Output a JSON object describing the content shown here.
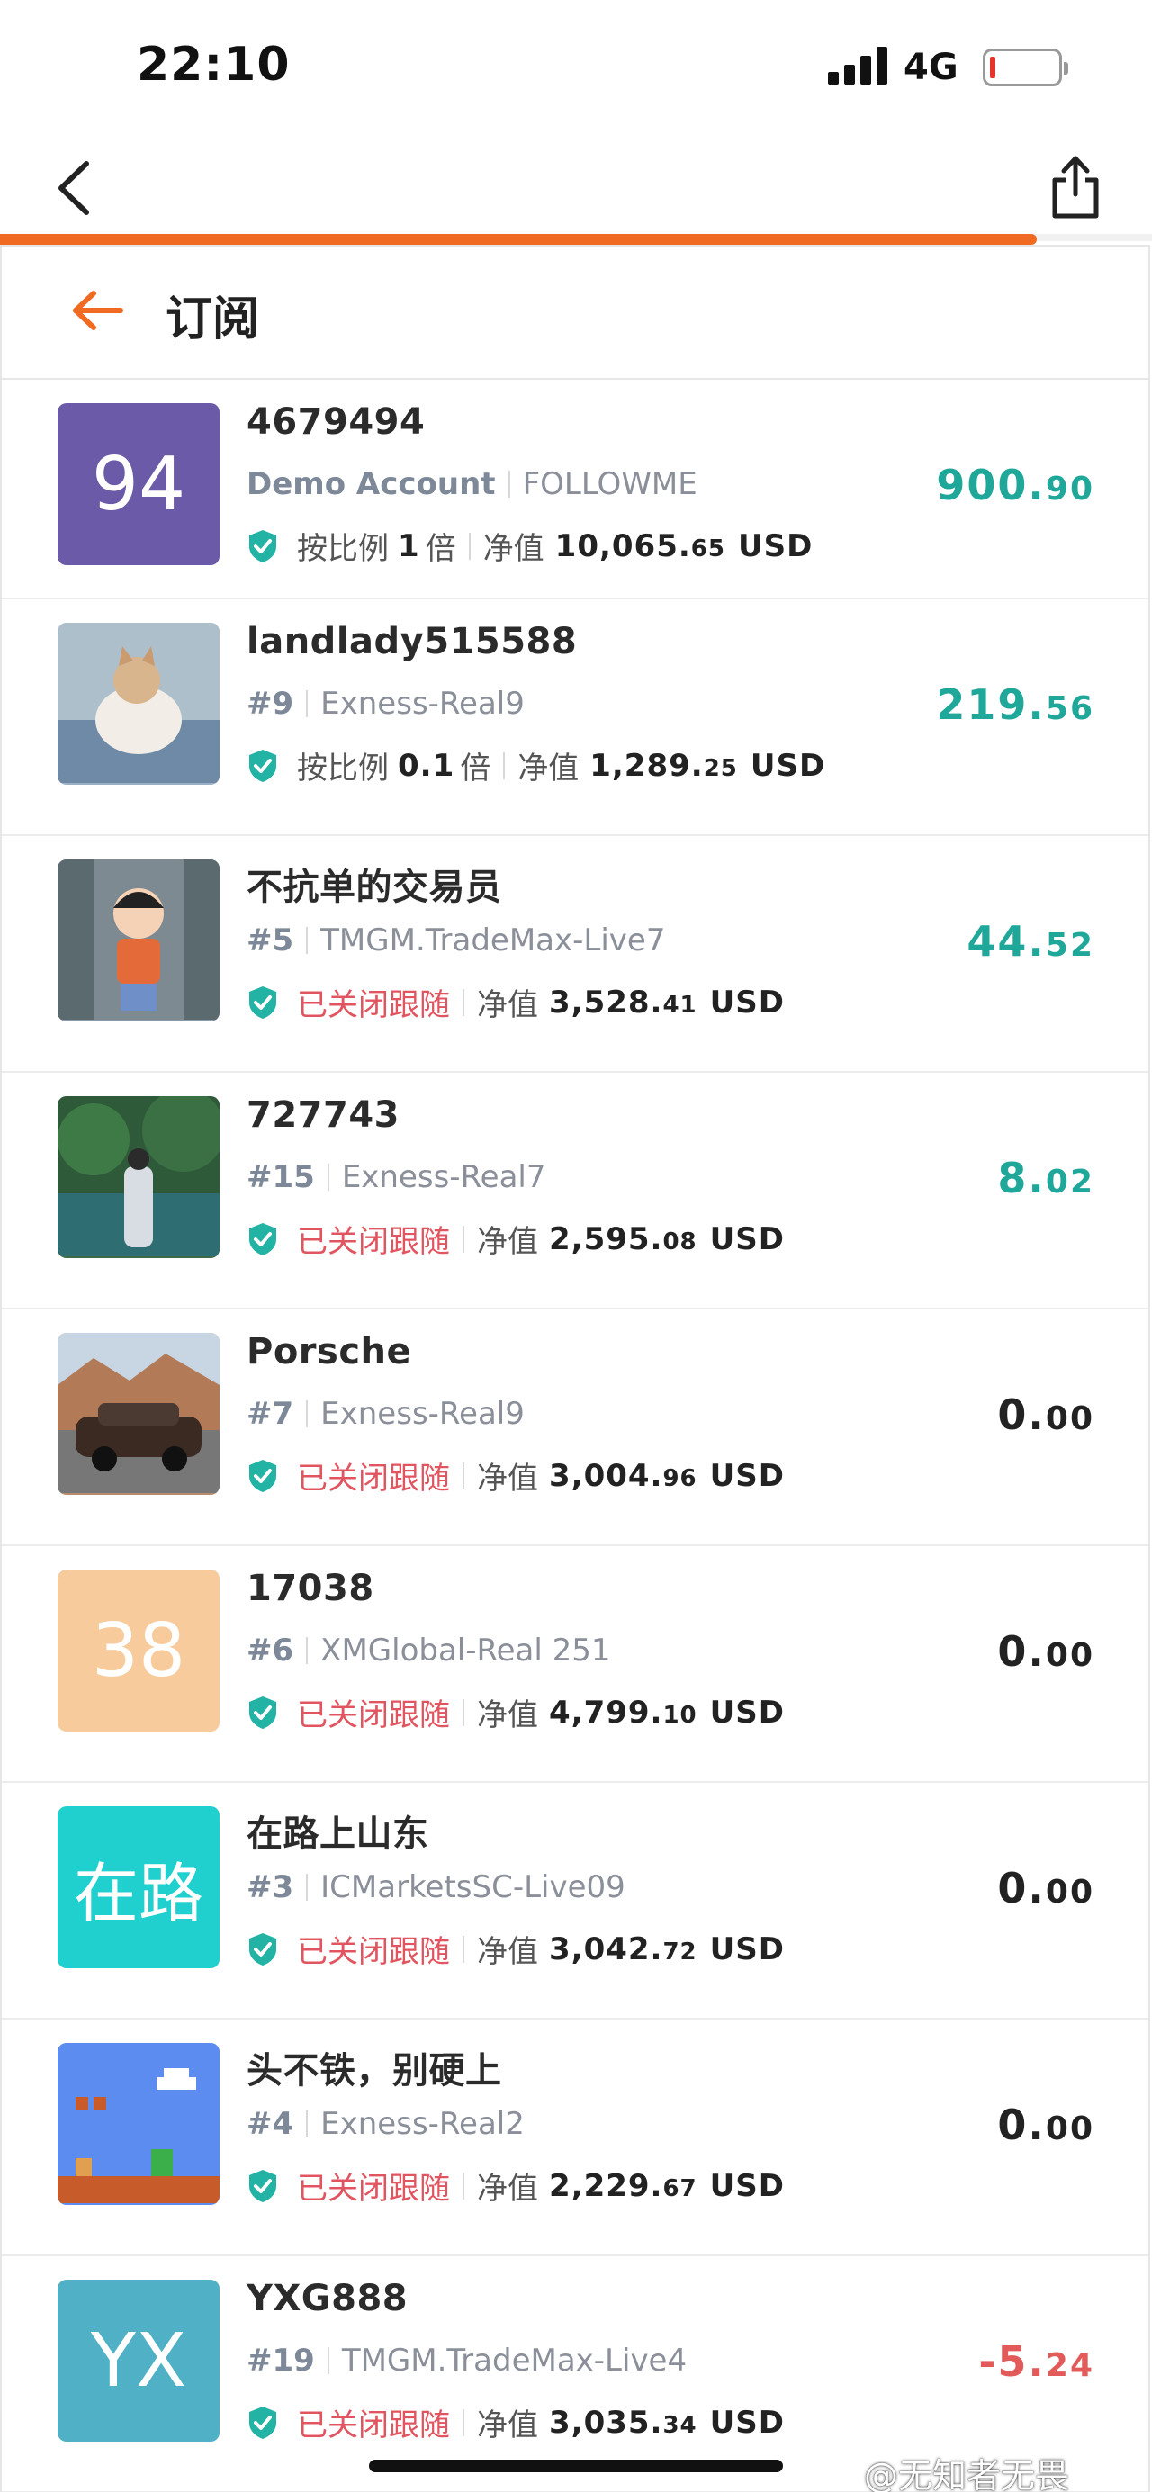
{
  "status_bar": {
    "time": "22:10",
    "network": "4G"
  },
  "page": {
    "title": "订阅",
    "load_progress": 0.9
  },
  "colors": {
    "accent": "#f06a22",
    "profit_positive": "#1fa89a",
    "profit_negative": "#e35a5a",
    "stopped": "#e05560",
    "shield": "#22b3a5"
  },
  "subscriptions": [
    {
      "avatar_text": "94",
      "avatar_bg": "#6a5aa8",
      "avatar_icon": "text-avatar",
      "name": "4679494",
      "rank": "Demo Account",
      "server": "FOLLOWME",
      "status": "按比例",
      "ratio": "1",
      "ratio_unit": "倍",
      "equity_label": "净值",
      "equity_int": "10,065.",
      "equity_dec": "65",
      "currency": "USD",
      "profit_int": "900.",
      "profit_dec": "90",
      "profit_sign": "pos"
    },
    {
      "avatar_text": "",
      "avatar_bg": "#9bb0c4",
      "avatar_icon": "cat-photo-icon",
      "name": "landlady515588",
      "rank": "#9",
      "server": "Exness-Real9",
      "status": "按比例",
      "ratio": "0.1",
      "ratio_unit": "倍",
      "equity_label": "净值",
      "equity_int": "1,289.",
      "equity_dec": "25",
      "currency": "USD",
      "profit_int": "219.",
      "profit_dec": "56",
      "profit_sign": "pos"
    },
    {
      "avatar_text": "",
      "avatar_bg": "#8a9aa6",
      "avatar_icon": "cartoon-girl-icon",
      "name": "不抗单的交易员",
      "rank": "#5",
      "server": "TMGM.TradeMax-Live7",
      "status": "已关闭跟随",
      "equity_label": "净值",
      "equity_int": "3,528.",
      "equity_dec": "41",
      "currency": "USD",
      "profit_int": "44.",
      "profit_dec": "52",
      "profit_sign": "pos"
    },
    {
      "avatar_text": "",
      "avatar_bg": "#3f6a4a",
      "avatar_icon": "lake-person-icon",
      "name": "727743",
      "rank": "#15",
      "server": "Exness-Real7",
      "status": "已关闭跟随",
      "equity_label": "净值",
      "equity_int": "2,595.",
      "equity_dec": "08",
      "currency": "USD",
      "profit_int": "8.",
      "profit_dec": "02",
      "profit_sign": "pos"
    },
    {
      "avatar_text": "",
      "avatar_bg": "#b98a6c",
      "avatar_icon": "car-photo-icon",
      "name": "Porsche",
      "rank": "#7",
      "server": "Exness-Real9",
      "status": "已关闭跟随",
      "equity_label": "净值",
      "equity_int": "3,004.",
      "equity_dec": "96",
      "currency": "USD",
      "profit_int": "0.",
      "profit_dec": "00",
      "profit_sign": "zero"
    },
    {
      "avatar_text": "38",
      "avatar_bg": "#f7cb9c",
      "avatar_icon": "text-avatar",
      "name": "17038",
      "rank": "#6",
      "server": "XMGlobal-Real 251",
      "status": "已关闭跟随",
      "equity_label": "净值",
      "equity_int": "4,799.",
      "equity_dec": "10",
      "currency": "USD",
      "profit_int": "0.",
      "profit_dec": "00",
      "profit_sign": "zero"
    },
    {
      "avatar_text": "在路",
      "avatar_bg": "#1fd0cf",
      "avatar_icon": "text-avatar",
      "name": "在路上山东",
      "rank": "#3",
      "server": "ICMarketsSC-Live09",
      "status": "已关闭跟随",
      "equity_label": "净值",
      "equity_int": "3,042.",
      "equity_dec": "72",
      "currency": "USD",
      "profit_int": "0.",
      "profit_dec": "00",
      "profit_sign": "zero"
    },
    {
      "avatar_text": "",
      "avatar_bg": "#5c8cf0",
      "avatar_icon": "pixel-game-icon",
      "name": "头不铁，别硬上",
      "rank": "#4",
      "server": "Exness-Real2",
      "status": "已关闭跟随",
      "equity_label": "净值",
      "equity_int": "2,229.",
      "equity_dec": "67",
      "currency": "USD",
      "profit_int": "0.",
      "profit_dec": "00",
      "profit_sign": "zero"
    },
    {
      "avatar_text": "YX",
      "avatar_bg": "#4fb0c6",
      "avatar_icon": "text-avatar",
      "name": "YXG888",
      "rank": "#19",
      "server": "TMGM.TradeMax-Live4",
      "status": "已关闭跟随",
      "equity_label": "净值",
      "equity_int": "3,035.",
      "equity_dec": "34",
      "currency": "USD",
      "profit_int": "-5.",
      "profit_dec": "24",
      "profit_sign": "neg"
    }
  ],
  "watermark": "@无知者无畏"
}
